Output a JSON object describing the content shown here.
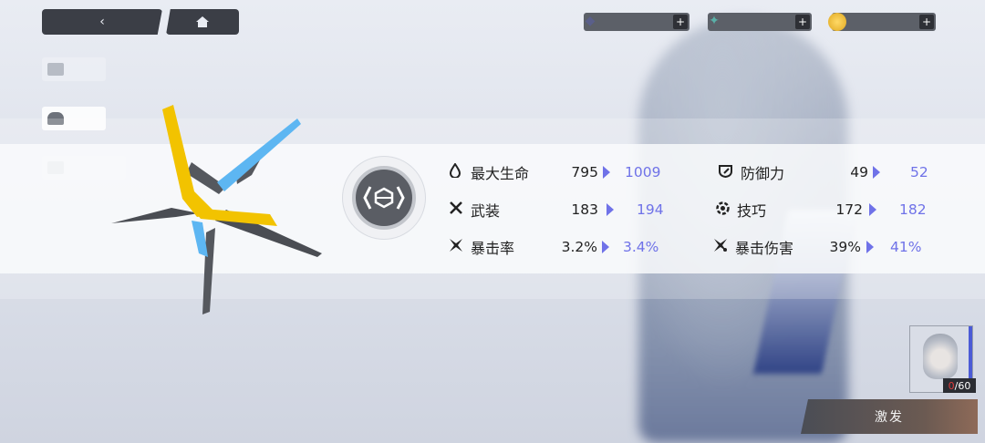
{
  "topbar": {
    "back_icon": "back-chevron-icon",
    "home_icon": "home-icon",
    "resources": [
      {
        "icon": "crystal-icon",
        "value": "",
        "plus": "+"
      },
      {
        "icon": "token-icon",
        "value": "",
        "plus": "+"
      },
      {
        "icon": "coin-icon",
        "value": "",
        "plus": "+"
      }
    ]
  },
  "sidebar": {
    "items": [
      {
        "icon": "overview-icon"
      },
      {
        "icon": "profile-icon",
        "selected": true
      },
      {
        "icon": "equipment-icon"
      }
    ]
  },
  "stats": [
    {
      "icon": "hp-drop-icon",
      "label": "最大生命",
      "current": "795",
      "next": "1009"
    },
    {
      "icon": "shield-icon",
      "label": "防御力",
      "current": "49",
      "next": "52"
    },
    {
      "icon": "cross-swords-icon",
      "label": "武装",
      "current": "183",
      "next": "194"
    },
    {
      "icon": "skill-gear-icon",
      "label": "技巧",
      "current": "172",
      "next": "182"
    },
    {
      "icon": "crit-rate-icon",
      "label": "暴击率",
      "current": "3.2%",
      "next": "3.4%"
    },
    {
      "icon": "crit-damage-icon",
      "label": "暴击伤害",
      "current": "39%",
      "next": "41%"
    }
  ],
  "character_card": {
    "level_current": "0",
    "level_max": "/60"
  },
  "activate_button": {
    "label": "激发"
  },
  "colors": {
    "accent": "#6f72e8",
    "panel": "#f7f8fa",
    "emblem_yellow": "#f2c300",
    "emblem_blue": "#5db6f2"
  }
}
